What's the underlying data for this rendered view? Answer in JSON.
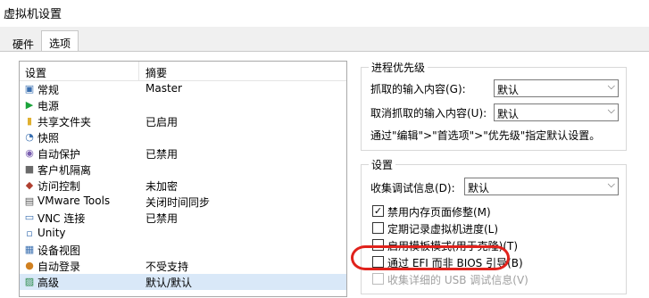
{
  "window": {
    "title": "虚拟机设置"
  },
  "tabs": [
    {
      "label": "硬件"
    },
    {
      "label": "选项"
    }
  ],
  "list": {
    "col_setting": "设置",
    "col_summary": "摘要",
    "rows": [
      {
        "icon": "general-icon",
        "glyph": "▣",
        "color": "#3a6fb0",
        "name": "常规",
        "summary": "Master"
      },
      {
        "icon": "power-icon",
        "glyph": "▶",
        "color": "#1aa33a",
        "name": "电源",
        "summary": ""
      },
      {
        "icon": "shared-folder-icon",
        "glyph": "▮",
        "color": "#e0b030",
        "name": "共享文件夹",
        "summary": "已启用"
      },
      {
        "icon": "snapshot-icon",
        "glyph": "◔",
        "color": "#3a6fb0",
        "name": "快照",
        "summary": ""
      },
      {
        "icon": "autoprotect-icon",
        "glyph": "◉",
        "color": "#7a5fb0",
        "name": "自动保护",
        "summary": "已禁用"
      },
      {
        "icon": "isolation-icon",
        "glyph": "■",
        "color": "#6a6a6a",
        "name": "客户机隔离",
        "summary": ""
      },
      {
        "icon": "access-control-icon",
        "glyph": "◆",
        "color": "#b04030",
        "name": "访问控制",
        "summary": "未加密"
      },
      {
        "icon": "vmware-tools-icon",
        "glyph": "▤",
        "color": "#5a5a5a",
        "name": "VMware Tools",
        "summary": "关闭时间同步"
      },
      {
        "icon": "vnc-icon",
        "glyph": "▭",
        "color": "#3a6fb0",
        "name": "VNC 连接",
        "summary": "已禁用"
      },
      {
        "icon": "unity-icon",
        "glyph": "▫",
        "color": "#3a6fb0",
        "name": "Unity",
        "summary": ""
      },
      {
        "icon": "appliance-view-icon",
        "glyph": "▦",
        "color": "#3a6fb0",
        "name": "设备视图",
        "summary": ""
      },
      {
        "icon": "autologin-icon",
        "glyph": "●",
        "color": "#d08020",
        "name": "自动登录",
        "summary": "不受支持"
      },
      {
        "icon": "advanced-icon",
        "glyph": "▨",
        "color": "#2a8a4a",
        "name": "高级",
        "summary": "默认/默认",
        "selected": true
      }
    ]
  },
  "process_priority": {
    "legend": "进程优先级",
    "grab_label": "抓取的输入内容(G):",
    "grab_value": "默认",
    "ungrab_label": "取消抓取的输入内容(U):",
    "ungrab_value": "默认",
    "note": "通过\"编辑\">\"首选项\">\"优先级\"指定默认设置。"
  },
  "settings": {
    "legend": "设置",
    "debug_label": "收集调试信息(D):",
    "debug_value": "默认",
    "checkboxes": [
      {
        "label": "禁用内存页面修整(M)",
        "checked": true,
        "enabled": true
      },
      {
        "label": "定期记录虚拟机进度(L)",
        "checked": false,
        "enabled": true
      },
      {
        "label": "启用模板模式(用于克隆)(T)",
        "checked": false,
        "enabled": true
      },
      {
        "label": "通过 EFI 而非 BIOS 引导(B)",
        "checked": false,
        "enabled": true
      },
      {
        "label": "收集详细的 USB 调试信息(V)",
        "checked": false,
        "enabled": false
      }
    ]
  }
}
